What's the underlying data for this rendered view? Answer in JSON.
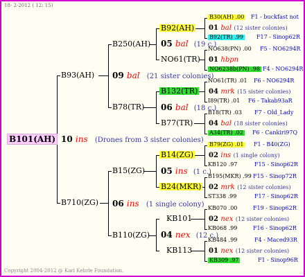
{
  "header": "18-  2-2012 ( 12: 15)",
  "footer": "Copyright 2004-2012 @ Karl Kehrle Foundation.",
  "root": {
    "label": "B101(AH)"
  },
  "gen1": {
    "num": "10",
    "name": "ins",
    "note": "(Drones from 3 sister colonies)",
    "upper": {
      "label": "B93(AH)"
    },
    "lower": {
      "label": "B710(ZG)"
    }
  },
  "gen2": [
    {
      "num": "09",
      "name": "bal",
      "note": "(21 sister colonies)",
      "upper": "B250(AH)",
      "lower": "B78(TR)"
    },
    {
      "num": "06",
      "name": "ins",
      "note": "(1 single colony)",
      "upper": "B15(ZG)",
      "lower": "B110(ZG)"
    }
  ],
  "gen3": [
    {
      "num": "05",
      "name": "bal",
      "note": "(19 c.)",
      "upper": "B92(AH)",
      "lower": "NO61(TR)"
    },
    {
      "num": "06",
      "name": "bal",
      "note": "(18 c.)",
      "upper": "B132(TR)",
      "lower": "B77(TR)"
    },
    {
      "num": "05",
      "name": "ins",
      "note": "(1 c.)",
      "upper": "B14(ZG)",
      "lower": "B24(MKR)"
    },
    {
      "num": "04",
      "name": "nex",
      "note": "(12 c.)",
      "upper": "KB101",
      "lower": "KB113"
    }
  ],
  "gen4": [
    {
      "upper": "B30(AH) .00",
      "upper_code": "F1 - buckfast not",
      "num": "01",
      "name": "bal",
      "note": "(12 sister colonies)",
      "lower": "B92(TR) .99",
      "lower_code": "F17 - Sinop62R"
    },
    {
      "upper": "NO638(PN) .00",
      "upper_code": "F5 - NO6294R",
      "num": "01",
      "name": "hbpn",
      "note": "",
      "lower": "NO6238b(PN) .98",
      "lower_code": "F4 - NO6294R"
    },
    {
      "upper": "NO61(TR) .01",
      "upper_code": "F6 - NO6294R",
      "num": "04",
      "name": "mrk",
      "note": "(15 sister colonies)",
      "lower": "I89(TR) .01",
      "lower_code": "F6 - Takab93aR"
    },
    {
      "upper": "B18(TR) .03",
      "upper_code": "F7 - Old_Lady",
      "num": "04",
      "name": "bal",
      "note": "(18 sister colonies)",
      "lower": "A34(TR) .02",
      "lower_code": "F6 - Cankiri97Q"
    },
    {
      "upper": "B79(ZG) .01",
      "upper_code": "F1 - B40(ZG)",
      "num": "02",
      "name": "ins",
      "note": "(1 single colony)",
      "lower": "KB120 .97",
      "lower_code": "F15 - Sinop62R"
    },
    {
      "upper": "B195(MKR) .99",
      "upper_code": "F15 - Sinop72R",
      "num": "02",
      "name": "mrk",
      "note": "(12 sister colonies)",
      "lower": "ST338 .99",
      "lower_code": "F17 - Sinop62R"
    },
    {
      "upper": "KB070 .00",
      "upper_code": "F19 - Sinop62R",
      "num": "02",
      "name": "nex",
      "note": "(12 sister colonies)",
      "lower": "KB068 .99",
      "lower_code": "F16 - Sinop62R"
    },
    {
      "upper": "KB484 .99",
      "upper_code": "F4 - Maced93R",
      "num": "01",
      "name": "nex",
      "note": "(12 sister colonies)",
      "lower": "KB309 .97",
      "lower_code": "F1 - Sinop96R"
    }
  ],
  "colors": {
    "border": "#d000d0",
    "yellow": "#ffff33",
    "cyan": "#33eeee",
    "green": "#33dd33",
    "pink": "#ffccff",
    "red": "#ff0000",
    "blue": "#3333aa"
  }
}
